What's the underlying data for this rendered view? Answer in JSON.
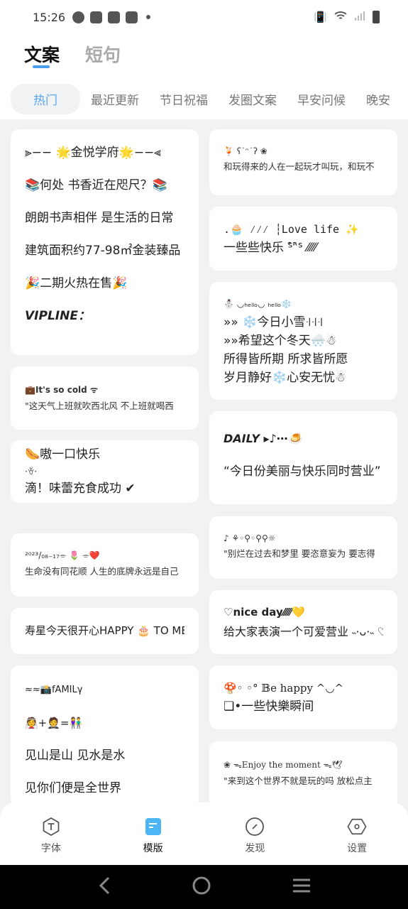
{
  "status": {
    "time": "15:26"
  },
  "main_tabs": [
    "文案",
    "短句"
  ],
  "categories": [
    "热门",
    "最近更新",
    "节日祝福",
    "发圈文案",
    "早安问候",
    "晚安"
  ],
  "left_cards": [
    [
      "⫸−− 🌟金悦学府🌟−−⫷",
      "📚何处 书香近在咫尺？📚",
      "朗朗书声相伴 是生活的日常",
      "建筑面积约77-98㎡金装臻品",
      "🎉二期火热在售🎉",
      "VIPLINE："
    ],
    [
      "💼It's so cold ᯤ",
      "\"这天气上班就吹西北风 不上班就喝西"
    ],
    [
      "🌭嗷一口快乐",
      "·ꈊ·",
      "滴！味蕾充食成功 ✔"
    ],
    [
      "²⁰²³/₀₈₋₁₇⌯ 🌷 ⌯❤️",
      "生命没有同花顺 人生的底牌永远是自己"
    ],
    [
      "寿星今天很开心HAPPY 🎂 TO ME"
    ],
    [
      "≈≈📸fAMILγ",
      "👰+🤵=👫",
      "见山是山 见水是水",
      "见你们便是全世界"
    ]
  ],
  "right_cards": [
    [
      "🍹 ʕ˙ᵔ˙ʔ ❀",
      "和玩得来的人在一起玩才叫玩，和玩不"
    ],
    [
      ".🧁 ⁄⁄⁄ ┆Love life ✨",
      "一些些快乐 ᔆ̑ᵔ̑ᔆ ⁄⁄⁄⁄⁄"
    ],
    [
      "⛄ ◡ₕₑₗₗₒ◡ ₕₑₗₗₒ❄️",
      "»» ❄️今日小雪꜊꜊꜊",
      "»»希望这个冬天🌨️☃",
      "所得皆所期 所求皆所愿",
      "岁月静好❄️心安无忧☃"
    ],
    [
      "DAILY ▸♪⋯🍮",
      "“今日份美丽与快乐同时营业”"
    ],
    [
      "♪ ⚘◦⚲◦⚲⚲☼",
      "\"别烂在过去和梦里 要恣意妄为  要志得"
    ],
    [
      "♡nice day⁄⁄⁄⁄⁄💛",
      "给大家表演一个可爱营业 ˵·ᴗ·˵ ♡"
    ],
    [
      "🍄◦ ◦° 𝔹e happy ^◡^",
      "❏•一些快樂瞬间"
    ],
    [
      "❀ ᯓEnjoy the moment ᯓ🕊",
      "\"来到这个世界不就是玩的吗  放松点主"
    ]
  ],
  "bottom_nav": [
    {
      "label": "字体",
      "icon": "font-icon"
    },
    {
      "label": "模版",
      "icon": "template-icon"
    },
    {
      "label": "发现",
      "icon": "discover-icon"
    },
    {
      "label": "设置",
      "icon": "settings-icon"
    }
  ],
  "colors": {
    "accent": "#4a9ef0",
    "active_category": "#5aa6ea",
    "template_icon": "#4cb6f5"
  }
}
